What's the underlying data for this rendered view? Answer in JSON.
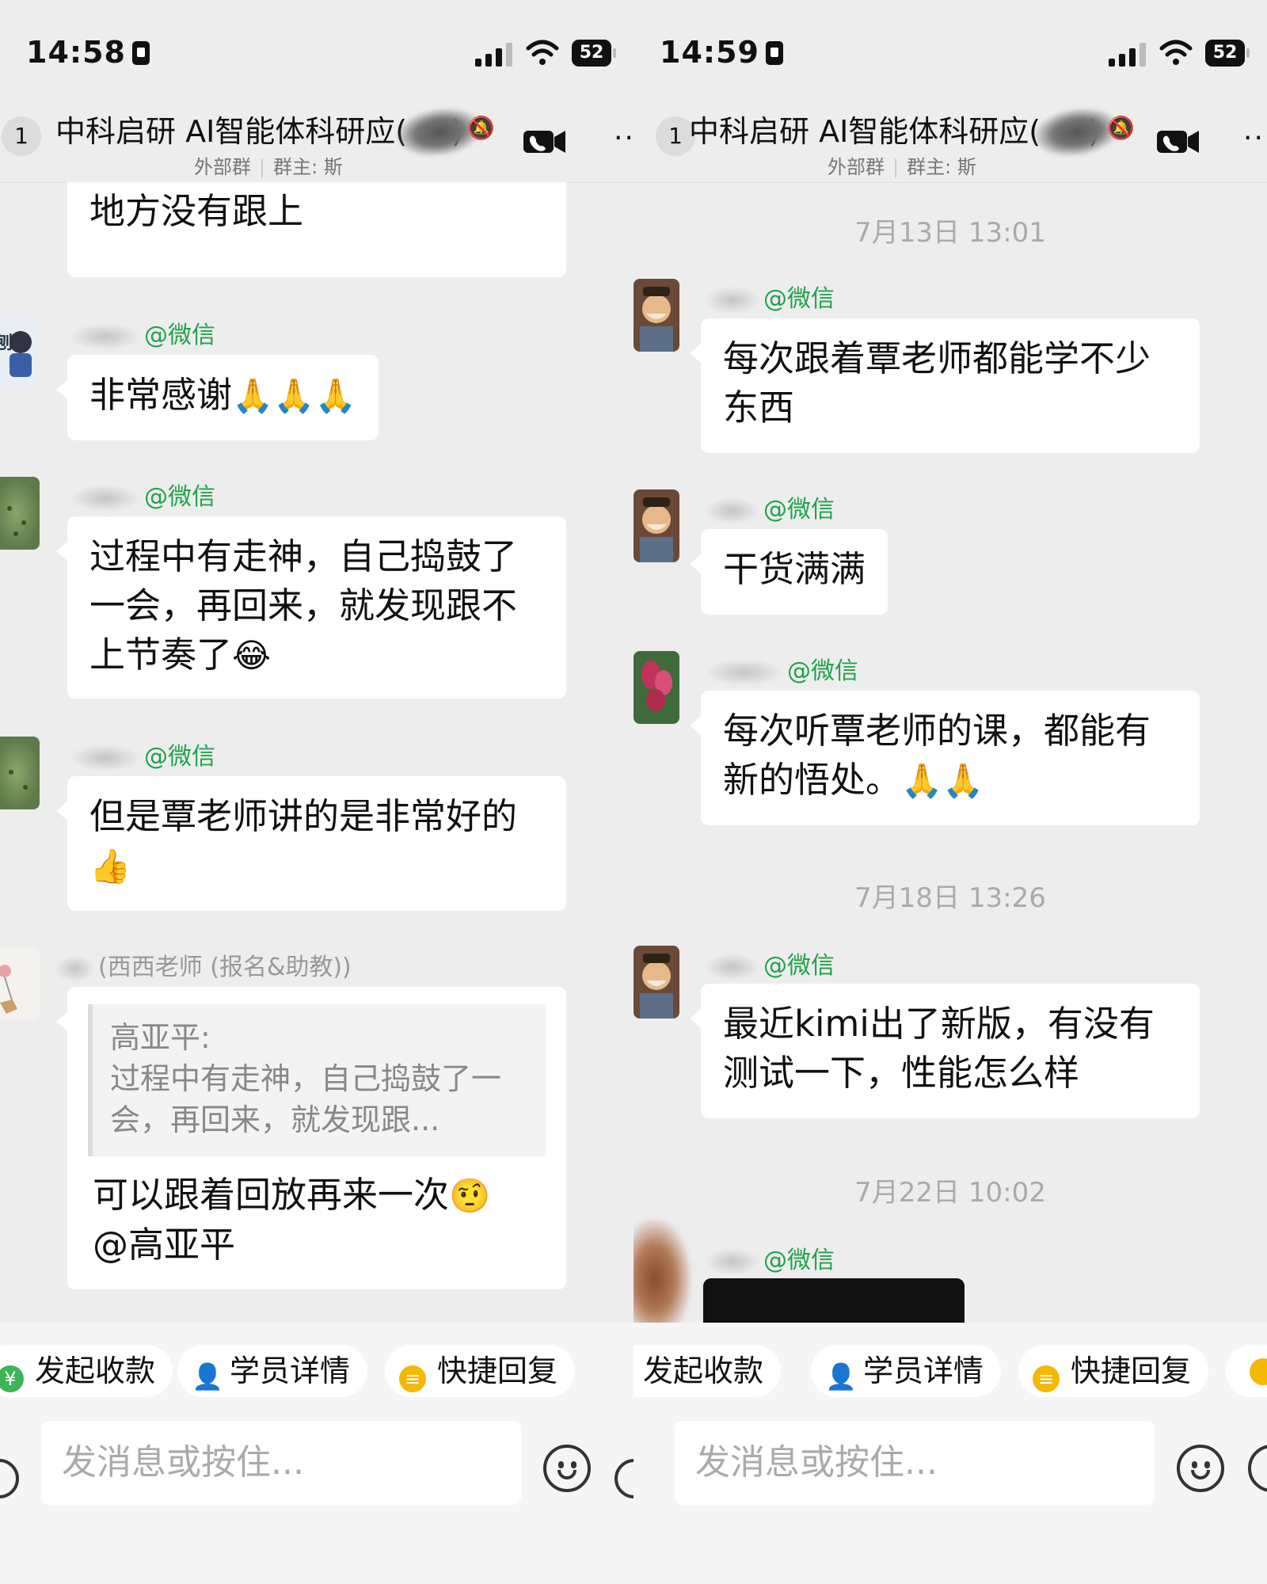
{
  "left": {
    "status": {
      "time": "14:58",
      "battery": "52"
    },
    "header": {
      "badge": "1",
      "title_visible": "中科启研 AI智能体科研应(",
      "title_tail": ")",
      "external": "外部群",
      "owner": "群主: 斯"
    },
    "messages": [
      {
        "text": "上课的过程中，确实有不少地方没有跟上"
      },
      {
        "sender_name": "刘飞",
        "sender_suffix": "@微信",
        "text": "非常感谢",
        "emoji": "🙏🙏🙏"
      },
      {
        "sender_name": "高平",
        "sender_suffix": "@微信",
        "text": "过程中有走神，自己捣鼓了一会，再回来，就发现跟不上节奏了",
        "emoji": "😂"
      },
      {
        "sender_name": "高亚平",
        "sender_suffix": "@微信",
        "text": "但是覃老师讲的是非常好的",
        "emoji": "👍"
      },
      {
        "sender_name": "新",
        "sender_suffix": "(西西老师 (报名&助教))",
        "quote_name": "高亚平:",
        "quote_text": "过程中有走神，自己捣鼓了一会，再回来，就发现跟...",
        "text": "可以跟着回放再来一次",
        "emoji": "🤨",
        "mention": "@高亚平"
      }
    ],
    "shortcuts": [
      "发起收款",
      "学员详情",
      "快捷回复"
    ],
    "input_placeholder": "发消息或按住..."
  },
  "right": {
    "status": {
      "time": "14:59",
      "battery": "52"
    },
    "header": {
      "badge": "1",
      "title_visible": "中科启研 AI智能体科研应(",
      "title_tail": ")",
      "external": "外部群",
      "owner": "群主: 斯"
    },
    "timestamps": [
      "7月13日 13:01",
      "7月18日 13:26",
      "7月22日 10:02"
    ],
    "messages": [
      {
        "sender_name": "财哥",
        "sender_suffix": "@微信",
        "text": "每次跟着覃老师都能学不少东西"
      },
      {
        "sender_name": "财哥",
        "sender_suffix": "@微信",
        "text": "干货满满"
      },
      {
        "sender_name": "张焱",
        "sender_suffix": "@微信",
        "text": "每次听覃老师的课，都能有新的悟处。",
        "emoji": "🙏🙏"
      },
      {
        "sender_name": "财哥",
        "sender_suffix": "@微信",
        "text": "最近kimi出了新版，有没有测试一下，性能怎么样"
      },
      {
        "sender_name": "财哥",
        "sender_suffix": "@微信"
      }
    ],
    "shortcuts": [
      "发起收款",
      "学员详情",
      "快捷回复"
    ],
    "input_placeholder": "发消息或按住..."
  },
  "colors": {
    "background": "#ededed",
    "bubble": "#ffffff",
    "wechat_green": "#20a34a",
    "meta_gray": "#999999"
  },
  "icons": [
    "lock-icon",
    "signal-icon",
    "wifi-icon",
    "battery-icon",
    "mute-icon",
    "video-call-icon",
    "more-icon",
    "payment-icon",
    "student-icon",
    "quick-reply-icon",
    "voice-icon",
    "emoji-icon",
    "plus-icon"
  ]
}
